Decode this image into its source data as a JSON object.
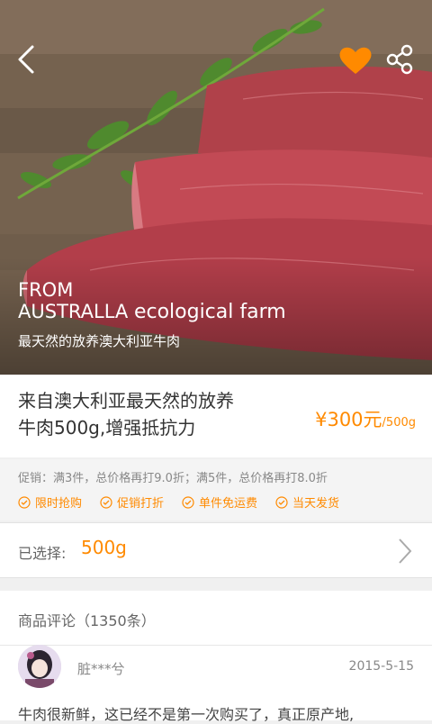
{
  "hero": {
    "line1": "FROM",
    "line2a": "AUSTRALLA",
    "line2b": "ecological farm",
    "subtitle": "最天然的放养澳大利亚牛肉"
  },
  "header_icons": {
    "back": "chevron-left-icon",
    "favorite": "heart-icon",
    "share": "share-icon"
  },
  "product": {
    "title_line1": "来自澳大利亚最天然的放养",
    "title_line2": "牛肉500g,增强抵抗力",
    "price": "¥300元",
    "price_unit": "/500g"
  },
  "promo": {
    "text": "促销：满3件，总价格再打9.0折；满5件，总价格再打8.0折",
    "tags": [
      "限时抢购",
      "促销打折",
      "单件免运费",
      "当天发货"
    ]
  },
  "selection": {
    "label": "已选择:",
    "value": "500g"
  },
  "reviews": {
    "header": "商品评论（1350条）",
    "items": [
      {
        "user": "脏***兮",
        "date": "2015-5-15",
        "text": "牛肉很新鲜，这已经不是第一次购买了，真正原产地,"
      }
    ]
  },
  "colors": {
    "accent": "#ff8a00"
  }
}
